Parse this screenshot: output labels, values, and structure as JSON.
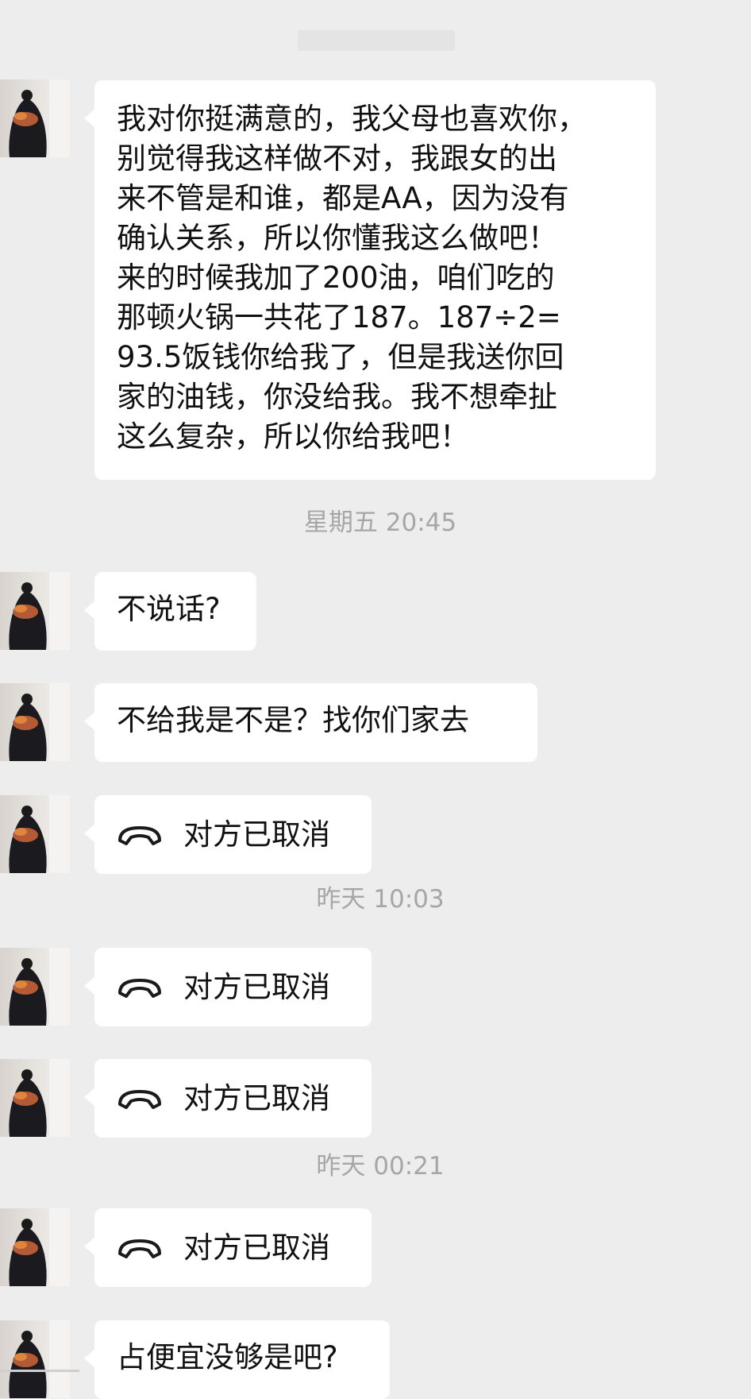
{
  "messages": {
    "m1": "我对你挺满意的，我父母也喜欢你，\n别觉得我这样做不对，我跟女的出\n来不管是和谁，都是AA，因为没有\n确认关系，所以你懂我这么做吧！\n来的时候我加了200油，咱们吃的\n那顿火锅一共花了187。187÷2=\n93.5饭钱你给我了，但是我送你回\n家的油钱，你没给我。我不想牵扯\n这么复杂，所以你给我吧！",
    "m2": "不说话?",
    "m3": "不给我是不是？找你们家去",
    "call1": "对方已取消",
    "call2": "对方已取消",
    "call3": "对方已取消",
    "call4": "对方已取消",
    "m4": "占便宜没够是吧?"
  },
  "timestamps": {
    "t1": "星期五 20:45",
    "t2": "昨天 10:03",
    "t3": "昨天 00:21"
  },
  "icons": {
    "call": "phone-hangup-icon",
    "avatar": "avatar-silhouette"
  },
  "colors": {
    "background": "#ededed",
    "bubble": "#ffffff",
    "timestamp": "#a6a6a6"
  }
}
